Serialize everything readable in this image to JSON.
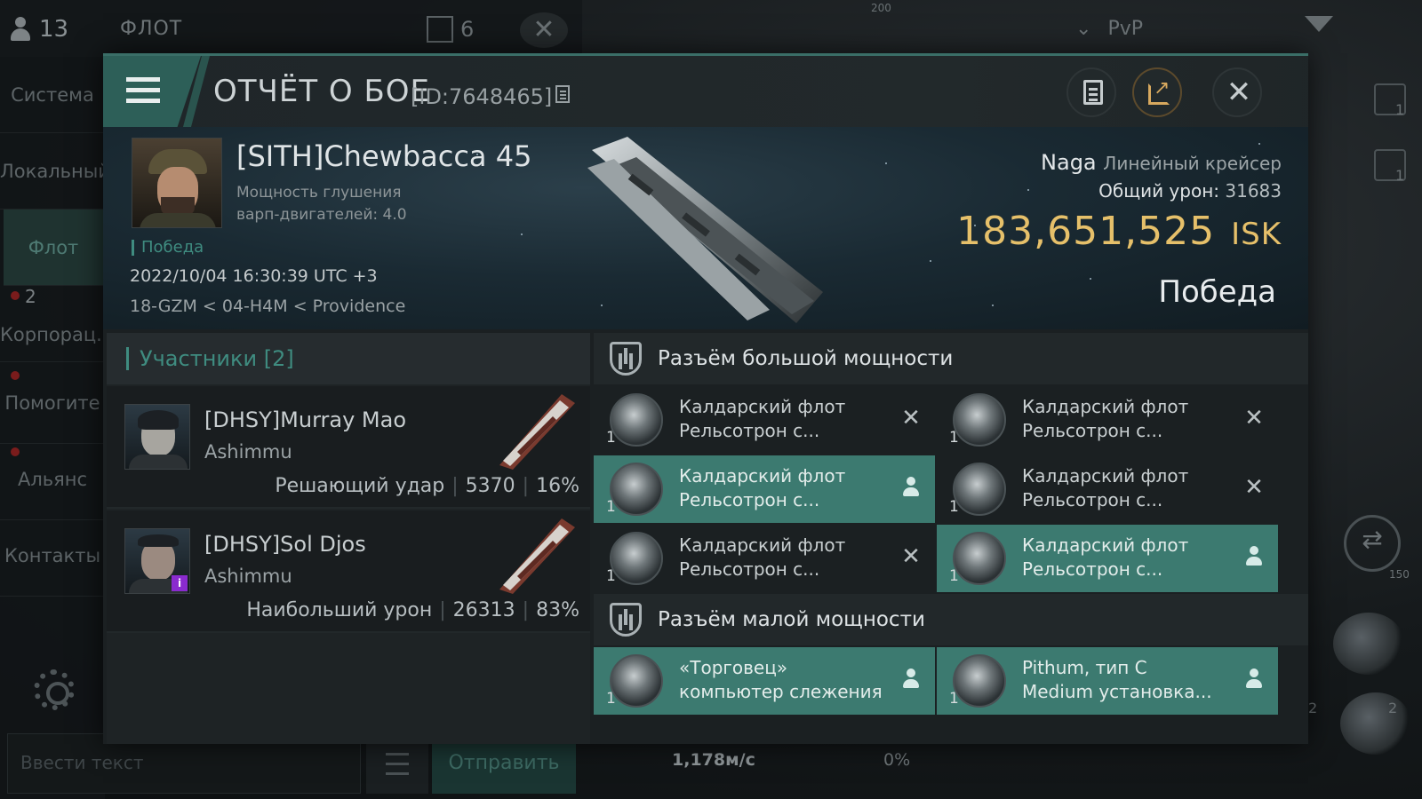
{
  "background": {
    "player_count": "13",
    "channel_name": "ФЛОТ",
    "box_count": "6",
    "pvp_label": "PvP",
    "side_nav": [
      {
        "label": "Система"
      },
      {
        "label": "Локальный"
      },
      {
        "label": "Флот"
      },
      {
        "label": "Корпорац..."
      },
      {
        "label": "Помогите"
      },
      {
        "label": "Альянс"
      },
      {
        "label": "Контакты"
      }
    ],
    "corp_badge": "2",
    "input_placeholder": "Ввести текст",
    "send_label": "Отправить",
    "speed": "1,178м/с",
    "percent": "0%",
    "scale_top": "200",
    "scale_right": "150",
    "side_count_1": "1",
    "side_count_2": "1",
    "ship_badge_1": "2",
    "ship_badge_2": "2"
  },
  "report": {
    "title": "ОТЧЁТ О БОЕ",
    "id_text": "[ID:7648465]",
    "pilot": {
      "name": "[SITH]Chewbacca 45",
      "stat_line1": "Мощность глушения",
      "stat_line2": "варп-двигателей: 4.0",
      "result_tag": "Победа",
      "timestamp": "2022/10/04 16:30:39 UTC +3",
      "location": "18-GZM < 04-H4M < Providence"
    },
    "ship": {
      "name": "Naga",
      "class": "Линейный крейсер",
      "damage_label": "Общий урон:",
      "damage_value": "31683",
      "isk_value": "183,651,525",
      "isk_unit": "ISK",
      "outcome": "Победа"
    },
    "participants": {
      "header": "Участники [2]",
      "list": [
        {
          "name": "[DHSY]Murray Mao",
          "ship": "Ashimmu",
          "role": "Решающий удар",
          "damage": "5370",
          "percent": "16%"
        },
        {
          "name": "[DHSY]Sol Djos",
          "ship": "Ashimmu",
          "role": "Наибольший урон",
          "damage": "26313",
          "percent": "83%"
        }
      ]
    },
    "high_slots": {
      "header": "Разъём большой мощности",
      "modules": [
        {
          "line1": "Калдарский флот",
          "line2": "Рельсотрон с...",
          "qty": "1",
          "state": "destroyed"
        },
        {
          "line1": "Калдарский флот",
          "line2": "Рельсотрон с...",
          "qty": "1",
          "state": "destroyed"
        },
        {
          "line1": "Калдарский флот",
          "line2": "Рельсотрон с...",
          "qty": "1",
          "state": "dropped"
        },
        {
          "line1": "Калдарский флот",
          "line2": "Рельсотрон с...",
          "qty": "1",
          "state": "destroyed"
        },
        {
          "line1": "Калдарский флот",
          "line2": "Рельсотрон с...",
          "qty": "1",
          "state": "destroyed"
        },
        {
          "line1": "Калдарский флот",
          "line2": "Рельсотрон с...",
          "qty": "1",
          "state": "dropped"
        }
      ]
    },
    "low_slots": {
      "header": "Разъём малой мощности",
      "modules": [
        {
          "line1": "«Торговец»",
          "line2": "компьютер слежения",
          "qty": "1",
          "state": "dropped"
        },
        {
          "line1": "Pithum, тип C",
          "line2": "Medium установка...",
          "qty": "1",
          "state": "dropped"
        }
      ]
    }
  },
  "colors": {
    "accent": "#3c7a70",
    "isk": "#e6c06a",
    "victory": "#3f8c80"
  }
}
